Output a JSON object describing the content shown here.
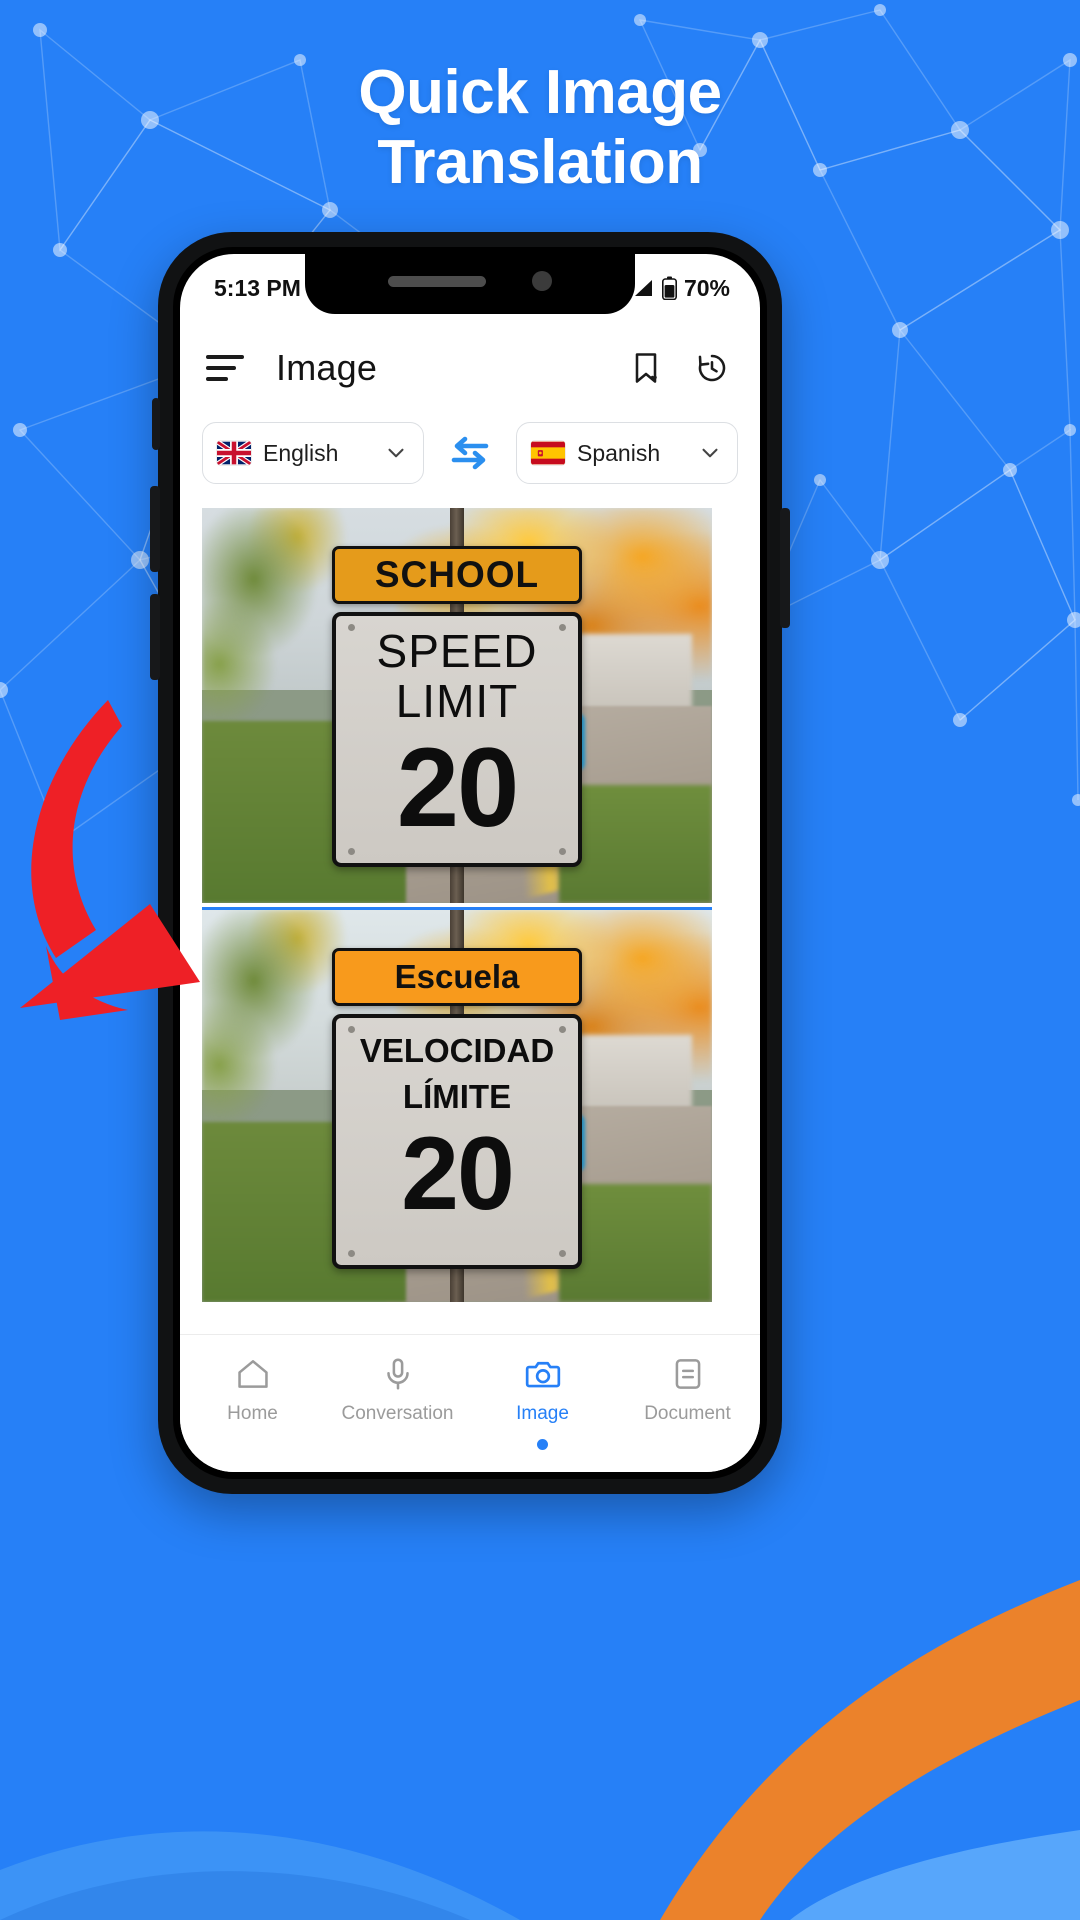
{
  "promo": {
    "headline_line1": "Quick Image",
    "headline_line2": "Translation",
    "background_color": "#2680F7",
    "accent_orange": "#F58220",
    "arrow_color": "#EE2026"
  },
  "phone": {
    "statusbar": {
      "time": "5:13 PM",
      "battery_percent": "70%",
      "signal_icon": "signal-bars-icon",
      "battery_icon": "battery-icon",
      "network_icon": "network-triangle-icon"
    },
    "header": {
      "menu_icon": "hamburger-menu-icon",
      "title": "Image",
      "bookmark_icon": "bookmark-favorite-icon",
      "history_icon": "history-clock-icon"
    },
    "language_bar": {
      "source": {
        "name": "English",
        "flag": "uk-flag-icon"
      },
      "target": {
        "name": "Spanish",
        "flag": "spain-flag-icon"
      },
      "swap_icon": "swap-arrows-icon",
      "chevron_icon": "chevron-down-icon"
    },
    "images": {
      "original": {
        "school_sign": "SCHOOL",
        "speed_line1": "SPEED",
        "speed_line2": "LIMIT",
        "speed_value": "20"
      },
      "translated": {
        "school_sign": "Escuela",
        "speed_line1": "VELOCIDAD",
        "speed_line2": "LÍMITE",
        "speed_value": "20"
      }
    },
    "tabbar": {
      "tabs": [
        {
          "label": "Home",
          "icon": "home-icon",
          "active": false
        },
        {
          "label": "Conversation",
          "icon": "microphone-icon",
          "active": false
        },
        {
          "label": "Image",
          "icon": "camera-icon",
          "active": true
        },
        {
          "label": "Document",
          "icon": "document-icon",
          "active": false
        }
      ]
    }
  }
}
